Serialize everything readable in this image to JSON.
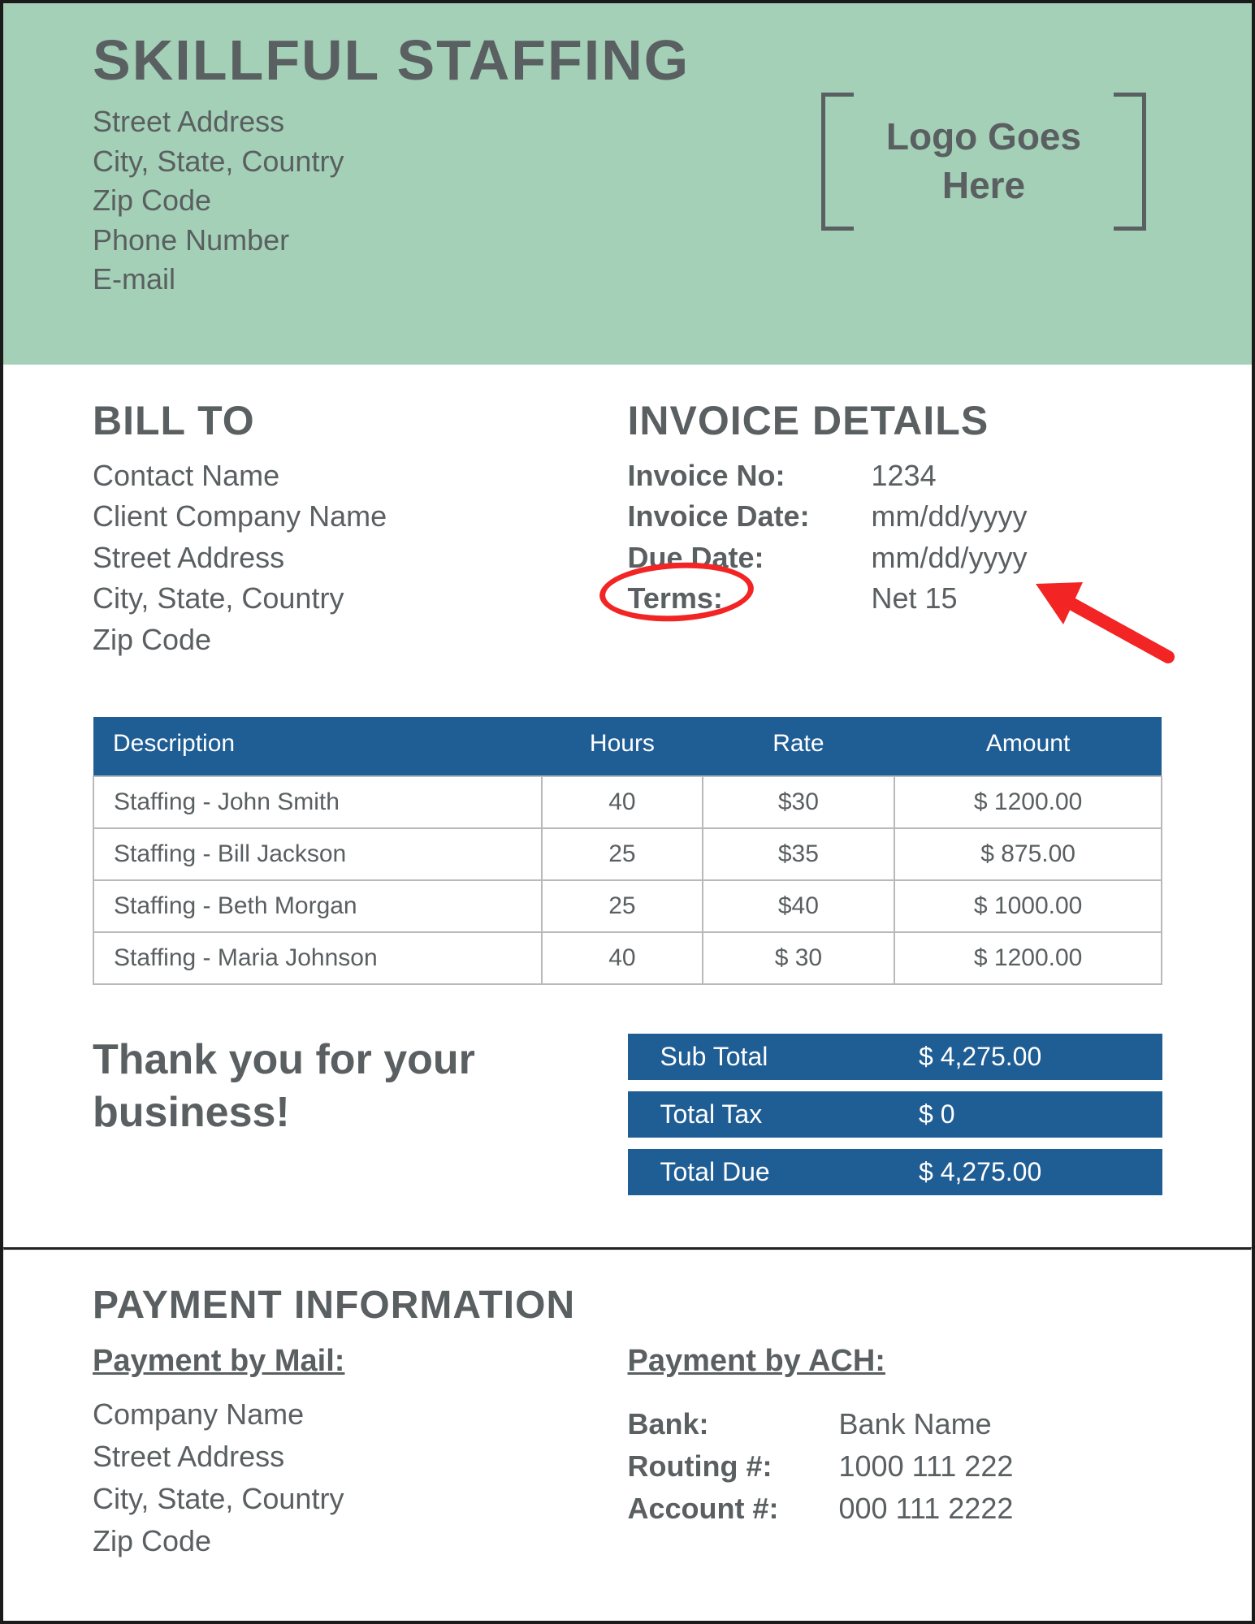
{
  "company": {
    "name": "SKILLFUL STAFFING",
    "address_lines": [
      "Street Address",
      "City, State, Country",
      "Zip Code",
      "Phone Number",
      "E-mail"
    ],
    "logo_line1": "Logo Goes",
    "logo_line2": "Here"
  },
  "bill_to": {
    "title": "BILL TO",
    "lines": [
      "Contact Name",
      "Client Company Name",
      "Street Address",
      "City, State, Country",
      "Zip Code"
    ]
  },
  "invoice": {
    "title": "INVOICE DETAILS",
    "rows": [
      {
        "label": "Invoice No:",
        "value": "1234"
      },
      {
        "label": "Invoice Date:",
        "value": "mm/dd/yyyy"
      },
      {
        "label": "Due Date:",
        "value": "mm/dd/yyyy"
      },
      {
        "label": "Terms:",
        "value": "Net 15"
      }
    ]
  },
  "items": {
    "headers": [
      "Description",
      "Hours",
      "Rate",
      "Amount"
    ],
    "rows": [
      {
        "desc": "Staffing - John Smith",
        "hours": "40",
        "rate": "$30",
        "amount": "$ 1200.00"
      },
      {
        "desc": "Staffing - Bill Jackson",
        "hours": "25",
        "rate": "$35",
        "amount": "$ 875.00"
      },
      {
        "desc": "Staffing - Beth Morgan",
        "hours": "25",
        "rate": "$40",
        "amount": "$ 1000.00"
      },
      {
        "desc": "Staffing - Maria Johnson",
        "hours": "40",
        "rate": "$ 30",
        "amount": "$ 1200.00"
      }
    ]
  },
  "thanks": {
    "line1": "Thank you for your",
    "line2": "business!"
  },
  "totals": [
    {
      "label": "Sub Total",
      "value": "$ 4,275.00"
    },
    {
      "label": "Total Tax",
      "value": "$ 0"
    },
    {
      "label": "Total Due",
      "value": "$ 4,275.00"
    }
  ],
  "payment": {
    "title": "PAYMENT INFORMATION",
    "mail": {
      "title": "Payment by Mail:",
      "lines": [
        "Company Name",
        "Street Address",
        "City, State, Country",
        "Zip Code"
      ]
    },
    "ach": {
      "title": "Payment by ACH:",
      "rows": [
        {
          "label": "Bank:",
          "value": "Bank Name"
        },
        {
          "label": "Routing #:",
          "value": "1000 111 222"
        },
        {
          "label": "Account #:",
          "value": "000 111 2222"
        }
      ]
    }
  },
  "colors": {
    "header_bg": "#a3d0b6",
    "table_header": "#1f5d95",
    "annotation": "#f22424"
  }
}
